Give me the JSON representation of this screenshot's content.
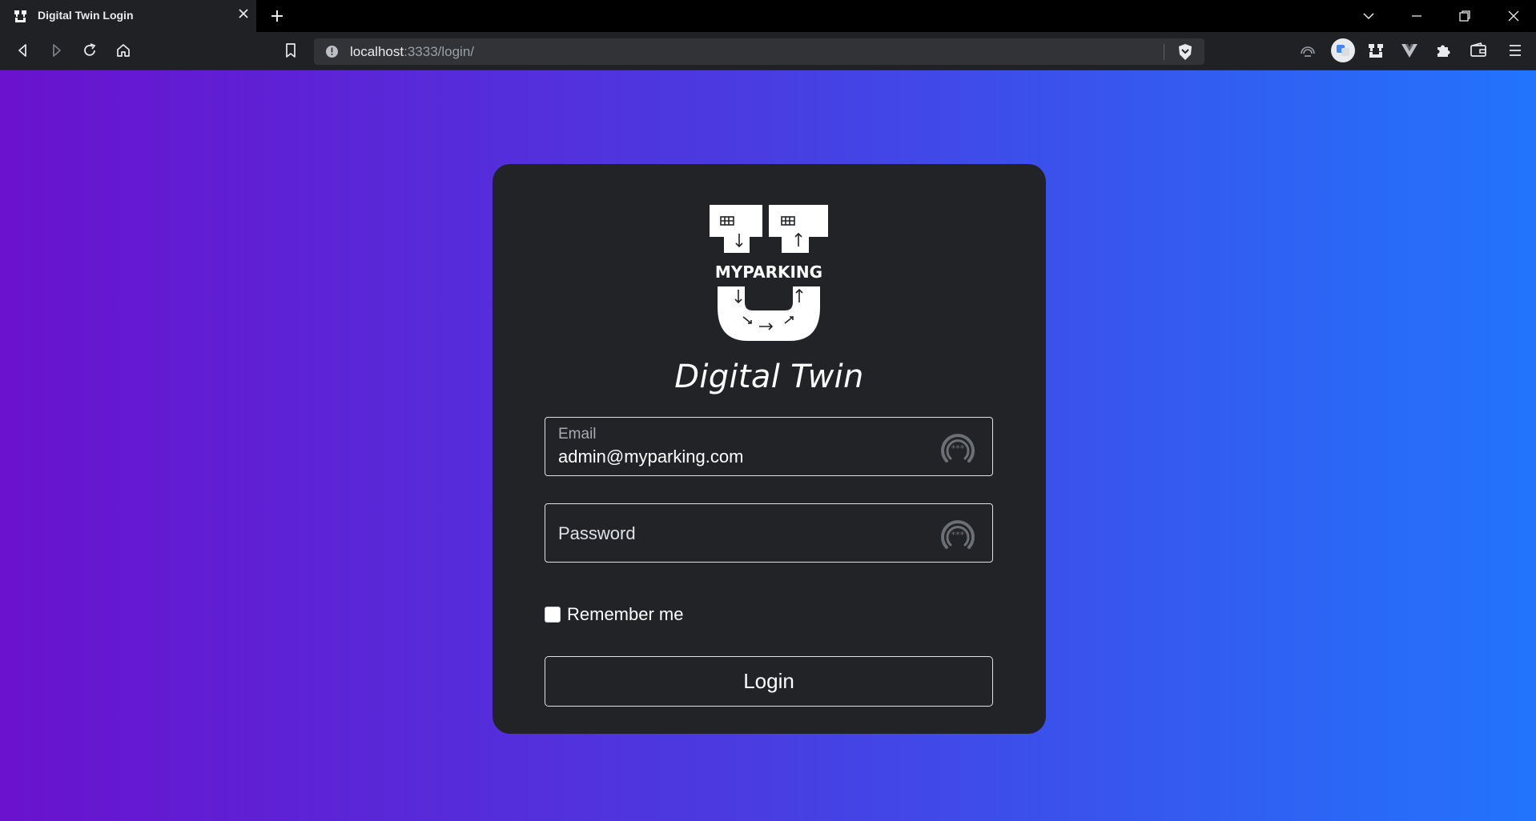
{
  "browser": {
    "tab_title": "Digital Twin Login",
    "url_host": "localhost",
    "url_rest": ":3333/login/"
  },
  "login": {
    "logo_text": "MYPARKING",
    "brand_title": "Digital Twin",
    "email_label": "Email",
    "email_value": "admin@myparking.com",
    "password_placeholder": "Password",
    "remember_label": "Remember me",
    "remember_checked": false,
    "login_button": "Login"
  },
  "colors": {
    "card_bg": "#222327",
    "gradient_start": "#6a12ce",
    "gradient_end": "#2274fd"
  }
}
